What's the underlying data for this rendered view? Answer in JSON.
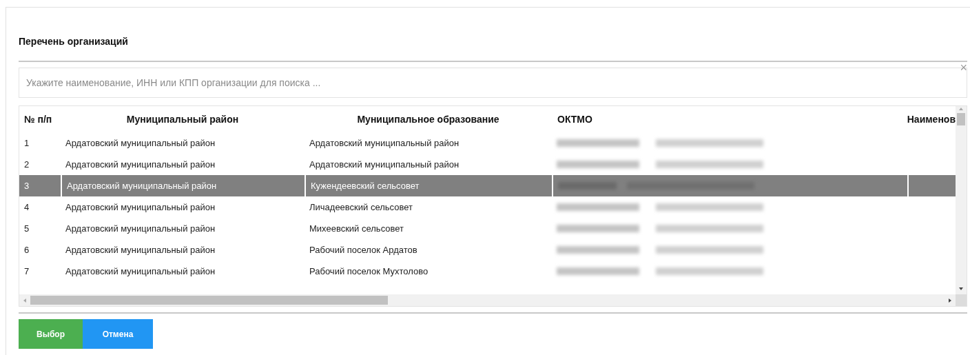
{
  "dialog": {
    "title": "Перечень организаций",
    "close": "×"
  },
  "search": {
    "placeholder": "Укажите наименование, ИНН или КПП организации для поиска ..."
  },
  "table": {
    "columns": [
      "№ п/п",
      "Муниципальный район",
      "Муниципальное образование",
      "ОКТМО",
      "Наименов"
    ],
    "rows": [
      {
        "number": "1",
        "district": "Ардатовский муниципальный район",
        "municipality": "Ардатовский муниципальный район",
        "selected": false
      },
      {
        "number": "2",
        "district": "Ардатовский муниципальный район",
        "municipality": "Ардатовский муниципальный район",
        "selected": false
      },
      {
        "number": "3",
        "district": "Ардатовский муниципальный район",
        "municipality": "Кужендеевский сельсовет",
        "selected": true
      },
      {
        "number": "4",
        "district": "Ардатовский муниципальный район",
        "municipality": "Личадеевский сельсовет",
        "selected": false
      },
      {
        "number": "5",
        "district": "Ардатовский муниципальный район",
        "municipality": "Михеевский сельсовет",
        "selected": false
      },
      {
        "number": "6",
        "district": "Ардатовский муниципальный район",
        "municipality": "Рабочий поселок Ардатов",
        "selected": false
      },
      {
        "number": "7",
        "district": "Ардатовский муниципальный район",
        "municipality": "Рабочий поселок Мухтолово",
        "selected": false
      }
    ]
  },
  "buttons": [
    {
      "label": "Выбор",
      "kind": "primary"
    },
    {
      "label": "Отмена",
      "kind": "cancel"
    }
  ]
}
